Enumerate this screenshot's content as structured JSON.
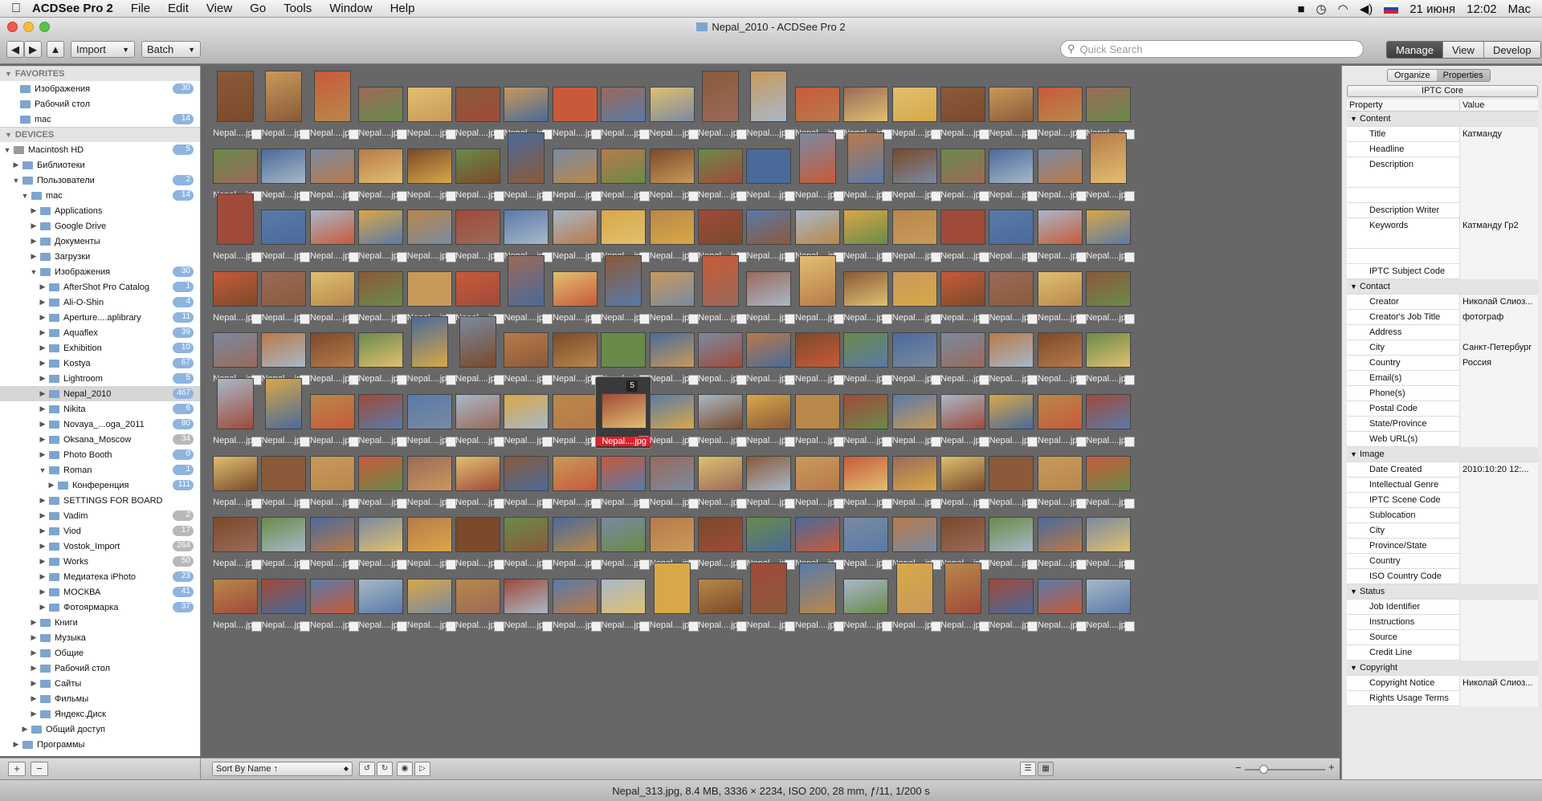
{
  "menubar": {
    "app": "ACDSee Pro 2",
    "menus": [
      "File",
      "Edit",
      "View",
      "Go",
      "Tools",
      "Window",
      "Help"
    ],
    "date": "21 июня",
    "time": "12:02",
    "user": "Mac"
  },
  "window": {
    "title": "Nepal_2010 - ACDSee Pro 2"
  },
  "toolbar": {
    "import": "Import",
    "batch": "Batch",
    "search_placeholder": "Quick Search",
    "modes": [
      "Manage",
      "View",
      "Develop"
    ]
  },
  "sidebar": {
    "favorites_header": "FAVORITES",
    "favorites": [
      {
        "label": "Изображения",
        "count": "30"
      },
      {
        "label": "Рабочий стол",
        "count": ""
      },
      {
        "label": "mac",
        "count": "14"
      }
    ],
    "devices_header": "DEVICES",
    "tree": [
      {
        "label": "Macintosh HD",
        "count": "5",
        "indent": 1,
        "tri": "▼",
        "hd": true
      },
      {
        "label": "Библиотеки",
        "count": "",
        "indent": 2,
        "tri": "▶"
      },
      {
        "label": "Пользователи",
        "count": "2",
        "indent": 2,
        "tri": "▼"
      },
      {
        "label": "mac",
        "count": "14",
        "indent": 3,
        "tri": "▼"
      },
      {
        "label": "Applications",
        "count": "",
        "indent": 4,
        "tri": "▶"
      },
      {
        "label": "Google Drive",
        "count": "",
        "indent": 4,
        "tri": "▶"
      },
      {
        "label": "Документы",
        "count": "",
        "indent": 4,
        "tri": "▶"
      },
      {
        "label": "Загрузки",
        "count": "",
        "indent": 4,
        "tri": "▶"
      },
      {
        "label": "Изображения",
        "count": "30",
        "indent": 4,
        "tri": "▼"
      },
      {
        "label": "AfterShot Pro Catalog",
        "count": "1",
        "indent": 5,
        "tri": "▶"
      },
      {
        "label": "Ali-O-Shin",
        "count": "4",
        "indent": 5,
        "tri": "▶"
      },
      {
        "label": "Aperture....aplibrary",
        "count": "11",
        "indent": 5,
        "tri": "▶"
      },
      {
        "label": "Aquaflex",
        "count": "39",
        "indent": 5,
        "tri": "▶"
      },
      {
        "label": "Exhibition",
        "count": "10",
        "indent": 5,
        "tri": "▶"
      },
      {
        "label": "Kostya",
        "count": "67",
        "indent": 5,
        "tri": "▶"
      },
      {
        "label": "Lightroom",
        "count": "5",
        "indent": 5,
        "tri": "▶"
      },
      {
        "label": "Nepal_2010",
        "count": "467",
        "indent": 5,
        "tri": "▶",
        "sel": true
      },
      {
        "label": "Nikita",
        "count": "6",
        "indent": 5,
        "tri": "▶"
      },
      {
        "label": "Novaya_...oga_2011",
        "count": "80",
        "indent": 5,
        "tri": "▶"
      },
      {
        "label": "Oksana_Moscow",
        "count": "34",
        "indent": 5,
        "tri": "▶",
        "gray": true
      },
      {
        "label": "Photo Booth",
        "count": "0",
        "indent": 5,
        "tri": "▶"
      },
      {
        "label": "Roman",
        "count": "1",
        "indent": 5,
        "tri": "▼"
      },
      {
        "label": "Конференция",
        "count": "111",
        "indent": 6,
        "tri": "▶"
      },
      {
        "label": "SETTINGS FOR BOARD",
        "count": "",
        "indent": 5,
        "tri": "▶"
      },
      {
        "label": "Vadim",
        "count": "2",
        "indent": 5,
        "tri": "▶",
        "gray": true
      },
      {
        "label": "Viod",
        "count": "17",
        "indent": 5,
        "tri": "▶",
        "gray": true
      },
      {
        "label": "Vostok_Import",
        "count": "264",
        "indent": 5,
        "tri": "▶",
        "gray": true
      },
      {
        "label": "Works",
        "count": "50",
        "indent": 5,
        "tri": "▶",
        "gray": true
      },
      {
        "label": "Медиатека iPhoto",
        "count": "23",
        "indent": 5,
        "tri": "▶"
      },
      {
        "label": "МОСКВА",
        "count": "41",
        "indent": 5,
        "tri": "▶"
      },
      {
        "label": "Фотоярмарка",
        "count": "37",
        "indent": 5,
        "tri": "▶"
      },
      {
        "label": "Книги",
        "count": "",
        "indent": 4,
        "tri": "▶"
      },
      {
        "label": "Музыка",
        "count": "",
        "indent": 4,
        "tri": "▶"
      },
      {
        "label": "Общие",
        "count": "",
        "indent": 4,
        "tri": "▶"
      },
      {
        "label": "Рабочий стол",
        "count": "",
        "indent": 4,
        "tri": "▶"
      },
      {
        "label": "Сайты",
        "count": "",
        "indent": 4,
        "tri": "▶"
      },
      {
        "label": "Фильмы",
        "count": "",
        "indent": 4,
        "tri": "▶"
      },
      {
        "label": "Яндекс.Диск",
        "count": "",
        "indent": 4,
        "tri": "▶"
      },
      {
        "label": "Общий доступ",
        "count": "",
        "indent": 3,
        "tri": "▶"
      },
      {
        "label": "Программы",
        "count": "",
        "indent": 2,
        "tri": "▶"
      }
    ],
    "add_btn": "+",
    "remove_btn": "−"
  },
  "browser": {
    "filename": "Nepal....jpg",
    "selected_badge": "5",
    "sort_label": "Sort By Name ↑"
  },
  "properties": {
    "tabs": [
      "Organize",
      "Properties"
    ],
    "schema": "IPTC Core",
    "col_property": "Property",
    "col_value": "Value",
    "rows": [
      {
        "k": "Content",
        "v": "",
        "g": true
      },
      {
        "k": "Title",
        "v": "Катманду"
      },
      {
        "k": "Headline",
        "v": ""
      },
      {
        "k": "Description",
        "v": "",
        "tall": true
      },
      {
        "k": "",
        "v": ""
      },
      {
        "k": "Description Writer",
        "v": ""
      },
      {
        "k": "Keywords",
        "v": "Катманду Гр2",
        "tall": true
      },
      {
        "k": "",
        "v": ""
      },
      {
        "k": "IPTC Subject Code",
        "v": ""
      },
      {
        "k": "Contact",
        "v": "",
        "g": true
      },
      {
        "k": "Creator",
        "v": "Николай Слиоз..."
      },
      {
        "k": "Creator's Job Title",
        "v": "фотограф"
      },
      {
        "k": "Address",
        "v": ""
      },
      {
        "k": "City",
        "v": "Санкт-Петербург"
      },
      {
        "k": "Country",
        "v": "Россия"
      },
      {
        "k": "Email(s)",
        "v": ""
      },
      {
        "k": "Phone(s)",
        "v": ""
      },
      {
        "k": "Postal Code",
        "v": ""
      },
      {
        "k": "State/Province",
        "v": ""
      },
      {
        "k": "Web URL(s)",
        "v": ""
      },
      {
        "k": "Image",
        "v": "",
        "g": true
      },
      {
        "k": "Date Created",
        "v": "2010:10:20 12:..."
      },
      {
        "k": "Intellectual Genre",
        "v": ""
      },
      {
        "k": "IPTC Scene Code",
        "v": ""
      },
      {
        "k": "Sublocation",
        "v": ""
      },
      {
        "k": "City",
        "v": ""
      },
      {
        "k": "Province/State",
        "v": ""
      },
      {
        "k": "Country",
        "v": ""
      },
      {
        "k": "ISO Country Code",
        "v": ""
      },
      {
        "k": "Status",
        "v": "",
        "g": true
      },
      {
        "k": "Job Identifier",
        "v": ""
      },
      {
        "k": "Instructions",
        "v": ""
      },
      {
        "k": "Source",
        "v": ""
      },
      {
        "k": "Credit Line",
        "v": ""
      },
      {
        "k": "Copyright",
        "v": "",
        "g": true
      },
      {
        "k": "Copyright Notice",
        "v": "Николай Слиоз..."
      },
      {
        "k": "Rights Usage Terms",
        "v": ""
      }
    ]
  },
  "status": {
    "text": "Nepal_313.jpg, 8.4 MB, 3336 × 2234, ISO 200, 28 mm, ƒ/11, 1/200 s"
  },
  "colors": {
    "accent": "#e0202c",
    "count_badge": "#8eb4e0",
    "grid_bg": "#676767"
  }
}
